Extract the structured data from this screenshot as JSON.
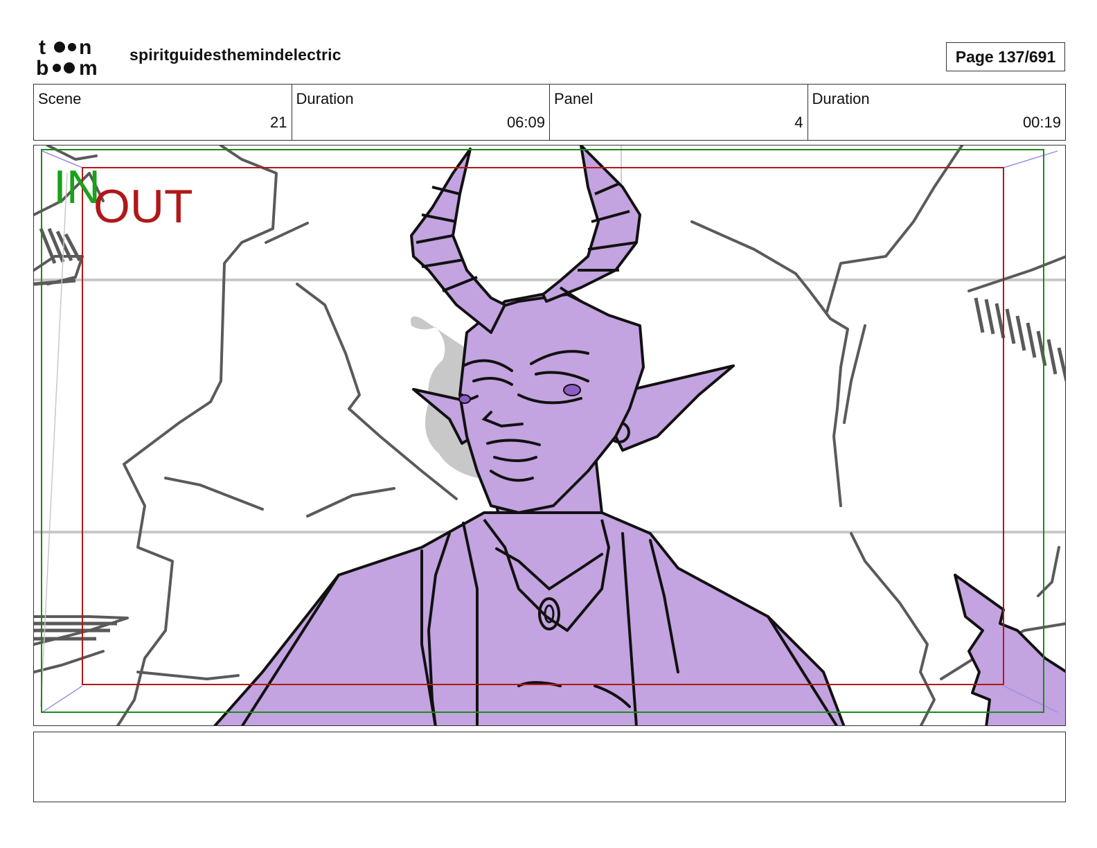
{
  "header": {
    "logo_top": "toon",
    "logo_bottom": "boom",
    "project_title": "spiritguidesthemindelectric",
    "page_label": "Page 137/691"
  },
  "info": [
    {
      "label": "Scene",
      "value": "21"
    },
    {
      "label": "Duration",
      "value": "06:09"
    },
    {
      "label": "Panel",
      "value": "4"
    },
    {
      "label": "Duration",
      "value": "00:19"
    }
  ],
  "panel": {
    "safe_in_label": "IN",
    "safe_out_label": "OUT",
    "colors": {
      "character_fill": "#c3a3e0",
      "safe_in": "#1a8a1a",
      "safe_out": "#b01818",
      "sketch_lines": "#5a5a5a"
    }
  },
  "notes": {
    "text": ""
  }
}
